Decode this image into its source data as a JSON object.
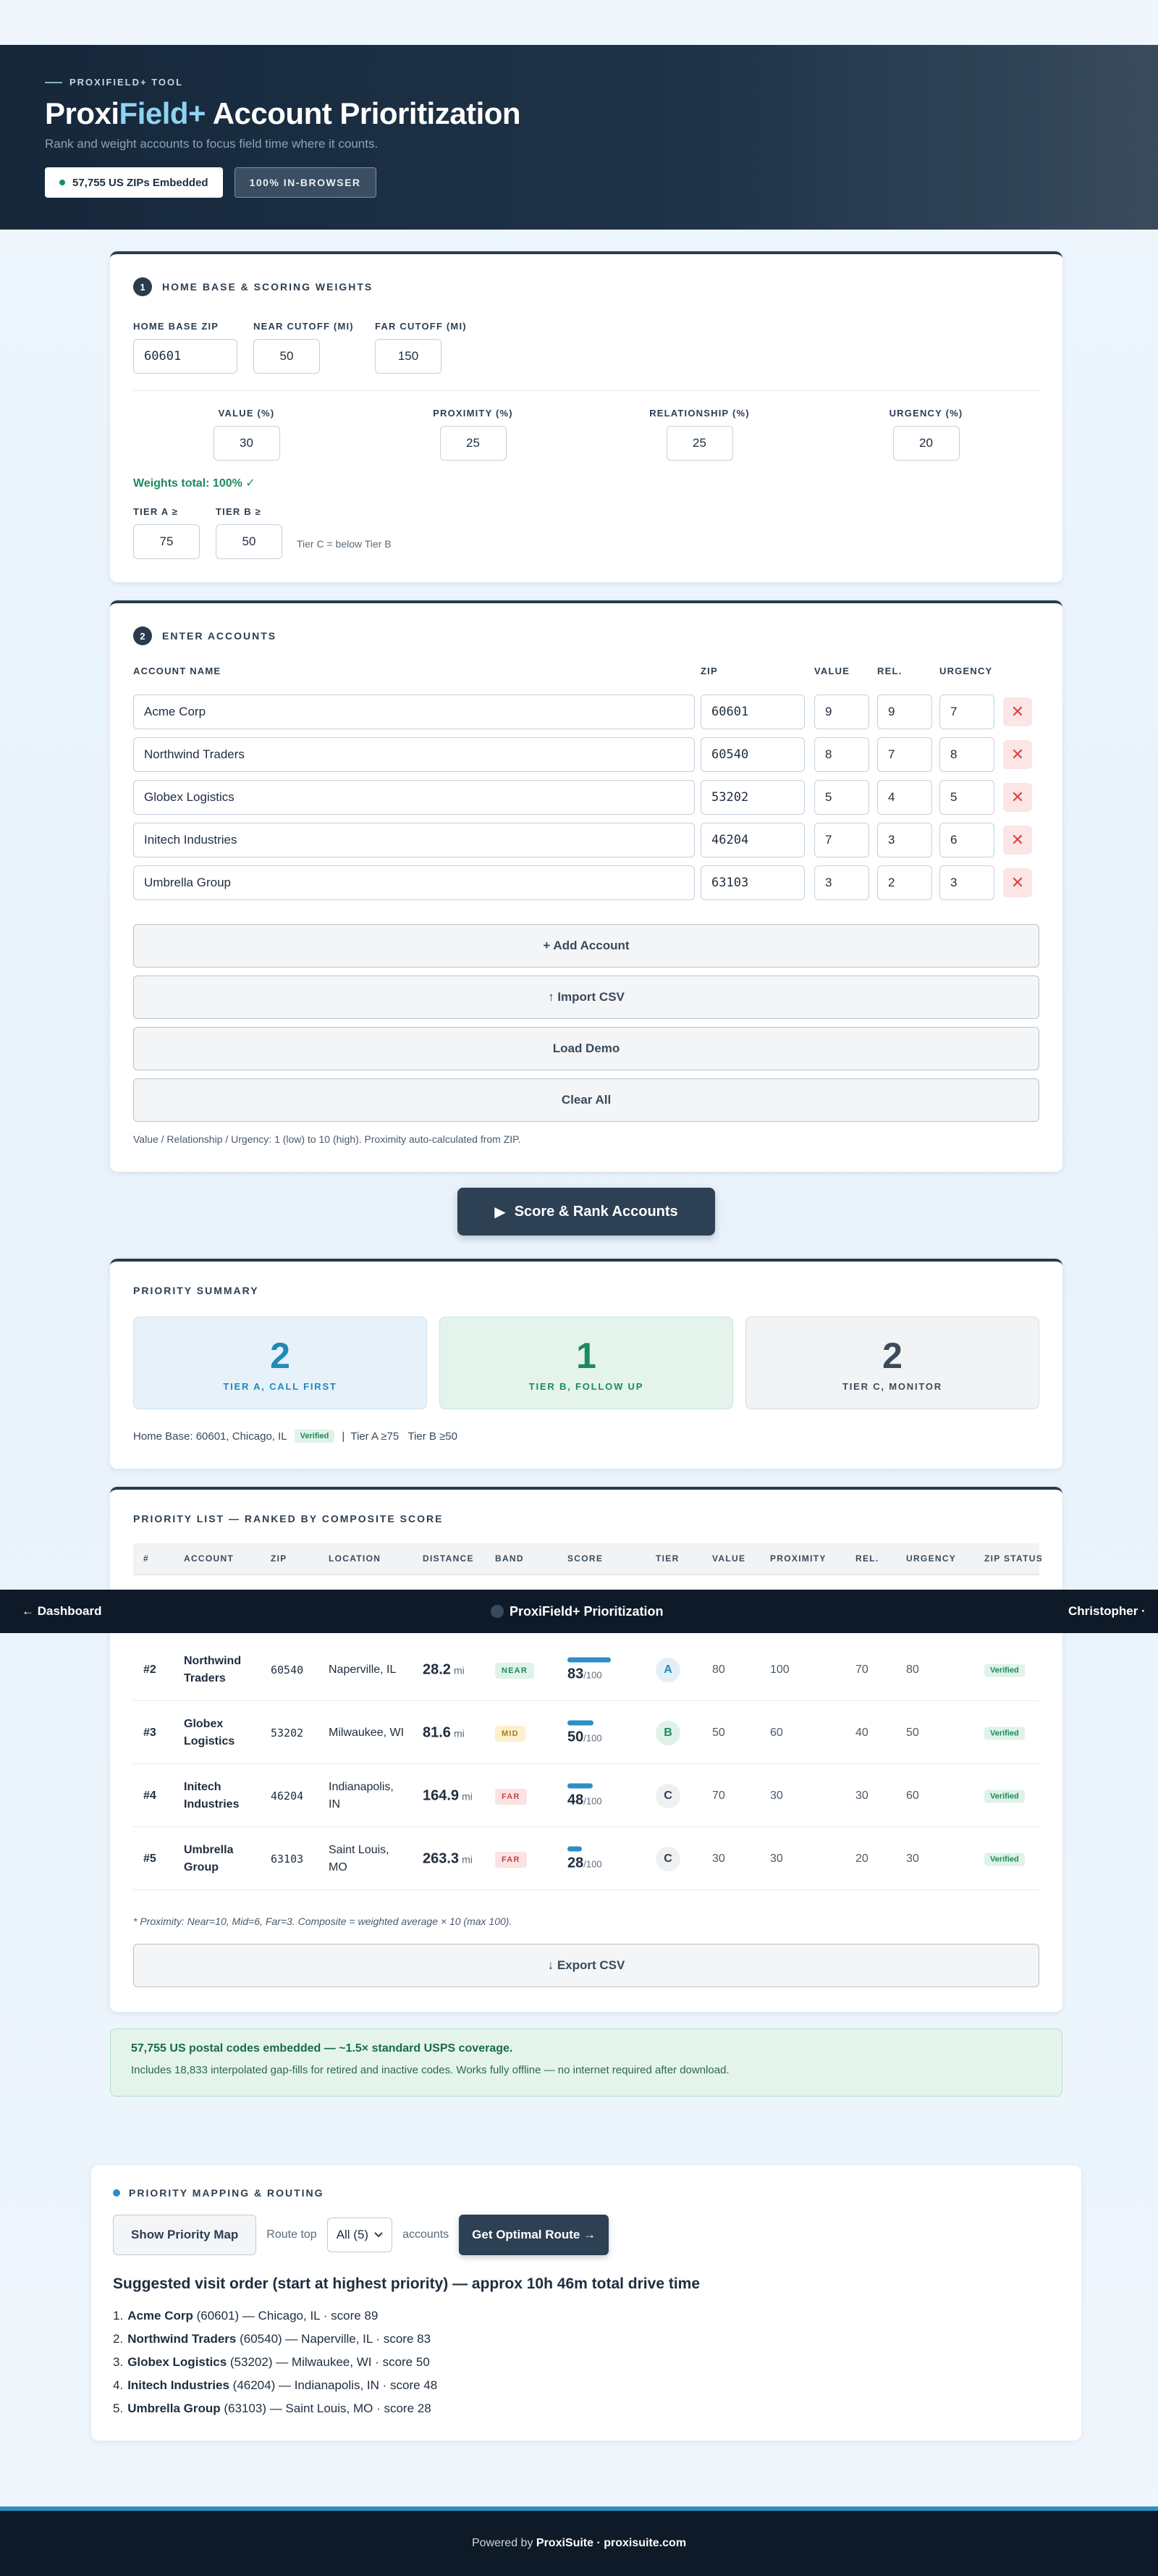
{
  "hero": {
    "eyebrow": "PROXIFIELD+ TOOL",
    "title_a": "Proxi",
    "title_b": "Field+",
    "title_c": " Account Prioritization",
    "subtitle": "Rank and weight accounts to focus field time where it counts.",
    "chip1": "57,755 US ZIPs Embedded",
    "chip2": "100% IN-BROWSER"
  },
  "section1": {
    "num": "1",
    "title": "HOME BASE & SCORING WEIGHTS",
    "home_zip_label": "HOME BASE ZIP",
    "home_zip": "60601",
    "near_label": "NEAR CUTOFF (MI)",
    "near": "50",
    "far_label": "FAR CUTOFF (MI)",
    "far": "150",
    "weights": [
      {
        "label": "VALUE (%)",
        "value": "30"
      },
      {
        "label": "PROXIMITY (%)",
        "value": "25"
      },
      {
        "label": "RELATIONSHIP (%)",
        "value": "25"
      },
      {
        "label": "URGENCY (%)",
        "value": "20"
      }
    ],
    "weights_total": "Weights total: 100% ✓",
    "tier_a_label": "TIER A ≥",
    "tier_a": "75",
    "tier_b_label": "TIER B ≥",
    "tier_b": "50",
    "tier_c_note": "Tier C = below Tier B"
  },
  "section2": {
    "num": "2",
    "title": "ENTER ACCOUNTS",
    "col_name": "ACCOUNT NAME",
    "col_zip": "ZIP",
    "col_value": "VALUE",
    "col_rel": "REL.",
    "col_urgency": "URGENCY",
    "accounts": [
      {
        "name": "Acme Corp",
        "zip": "60601",
        "value": "9",
        "rel": "9",
        "urgency": "7"
      },
      {
        "name": "Northwind Traders",
        "zip": "60540",
        "value": "8",
        "rel": "7",
        "urgency": "8"
      },
      {
        "name": "Globex Logistics",
        "zip": "53202",
        "value": "5",
        "rel": "4",
        "urgency": "5"
      },
      {
        "name": "Initech Industries",
        "zip": "46204",
        "value": "7",
        "rel": "3",
        "urgency": "6"
      },
      {
        "name": "Umbrella Group",
        "zip": "63103",
        "value": "3",
        "rel": "2",
        "urgency": "3"
      }
    ],
    "remove_glyph": "✕",
    "add_btn": "+ Add Account",
    "import_btn": "↑ Import CSV",
    "demo_btn": "Load Demo",
    "clear_btn": "Clear All",
    "hint": "Value / Relationship / Urgency: 1 (low) to 10 (high). Proximity auto-calculated from ZIP."
  },
  "score_btn": "Score & Rank Accounts",
  "score_btn_icon": "▶",
  "summary": {
    "title": "PRIORITY SUMMARY",
    "tiers": [
      {
        "count": "2",
        "label": "TIER A, CALL FIRST"
      },
      {
        "count": "1",
        "label": "TIER B, FOLLOW UP"
      },
      {
        "count": "2",
        "label": "TIER C, MONITOR"
      }
    ],
    "home_base": "Home Base: 60601, Chicago, IL",
    "verified": "Verified",
    "thresholds": "|  Tier A ≥75   Tier B ≥50"
  },
  "priority_list": {
    "title": "PRIORITY LIST — RANKED BY COMPOSITE SCORE",
    "headers": [
      "#",
      "ACCOUNT",
      "ZIP",
      "LOCATION",
      "DISTANCE",
      "BAND",
      "SCORE",
      "TIER",
      "VALUE",
      "PROXIMITY",
      "REL.",
      "URGENCY",
      "ZIP STATUS"
    ],
    "rows": [
      {
        "rank": "#2",
        "account": "Northwind Traders",
        "zip": "60540",
        "location": "Naperville, IL",
        "distance": "28.2",
        "band": "NEAR",
        "score": "83",
        "score_num": 83,
        "tier": "A",
        "value": "80",
        "proximity": "100",
        "rel": "70",
        "urgency": "80",
        "status": "Verified"
      },
      {
        "rank": "#3",
        "account": "Globex Logistics",
        "zip": "53202",
        "location": "Milwaukee, WI",
        "distance": "81.6",
        "band": "MID",
        "score": "50",
        "score_num": 50,
        "tier": "B",
        "value": "50",
        "proximity": "60",
        "rel": "40",
        "urgency": "50",
        "status": "Verified"
      },
      {
        "rank": "#4",
        "account": "Initech Industries",
        "zip": "46204",
        "location": "Indianapolis, IN",
        "distance": "164.9",
        "band": "FAR",
        "score": "48",
        "score_num": 48,
        "tier": "C",
        "value": "70",
        "proximity": "30",
        "rel": "30",
        "urgency": "60",
        "status": "Verified"
      },
      {
        "rank": "#5",
        "account": "Umbrella Group",
        "zip": "63103",
        "location": "Saint Louis, MO",
        "distance": "263.3",
        "band": "FAR",
        "score": "28",
        "score_num": 28,
        "tier": "C",
        "value": "30",
        "proximity": "30",
        "rel": "20",
        "urgency": "30",
        "status": "Verified"
      }
    ],
    "unit_mi": "mi",
    "score_suffix": "/100",
    "footnote": "* Proximity: Near=10, Mid=6, Far=3. Composite = weighted average × 10 (max 100).",
    "export_btn": "↓ Export CSV"
  },
  "navbar": {
    "back": "← Dashboard",
    "title": "ProxiField+ Prioritization",
    "user": "Christopher ·"
  },
  "note": {
    "line1": "57,755 US postal codes embedded — ~1.5× standard USPS coverage.",
    "line2": "Includes 18,833 interpolated gap-fills for retired and inactive codes. Works fully offline — no internet required after download."
  },
  "mapping": {
    "title": "PRIORITY MAPPING & ROUTING",
    "show_map": "Show Priority Map",
    "route_top": "Route top",
    "select_value": "All (5)",
    "accounts_word": "accounts",
    "route_btn": "Get Optimal Route →",
    "route_title": "Suggested visit order (start at highest priority) — approx 10h 46m total drive time",
    "route": [
      {
        "num": "1.",
        "name": "Acme Corp",
        "rest": " (60601) — Chicago, IL · score 89"
      },
      {
        "num": "2.",
        "name": "Northwind Traders",
        "rest": " (60540) — Naperville, IL · score 83"
      },
      {
        "num": "3.",
        "name": "Globex Logistics",
        "rest": " (53202) — Milwaukee, WI · score 50"
      },
      {
        "num": "4.",
        "name": "Initech Industries",
        "rest": " (46204) — Indianapolis, IN · score 48"
      },
      {
        "num": "5.",
        "name": "Umbrella Group",
        "rest": " (63103) — Saint Louis, MO · score 28"
      }
    ]
  },
  "footer": {
    "powered": "Powered by ",
    "brand": "ProxiSuite · proxisuite.com"
  }
}
